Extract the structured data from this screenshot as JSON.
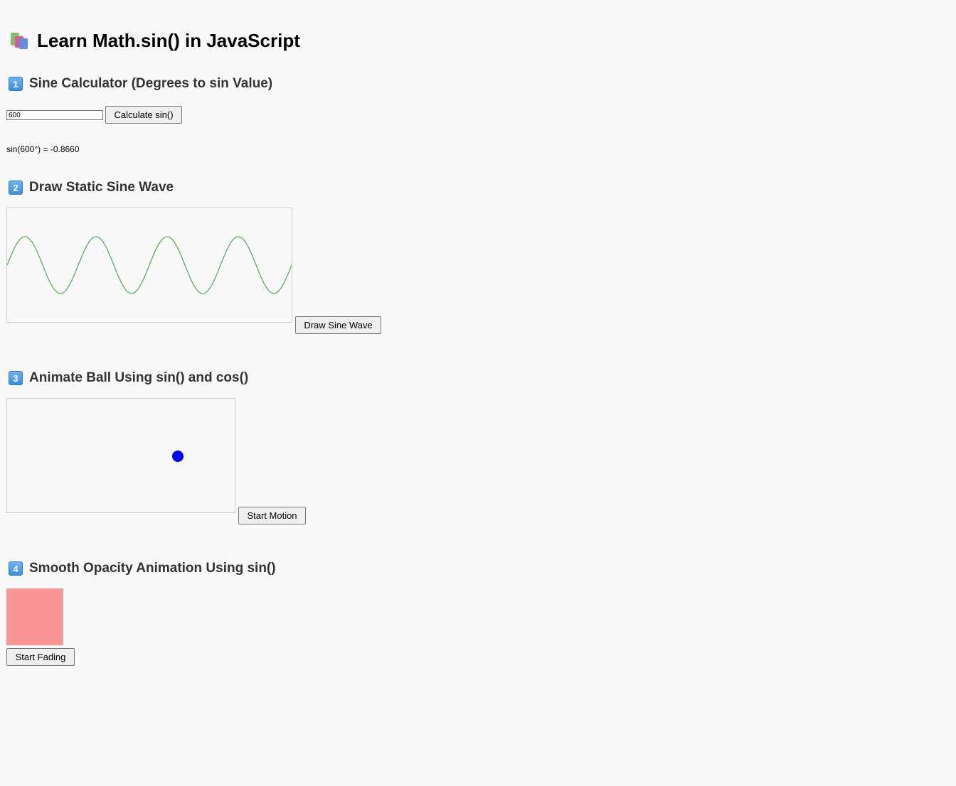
{
  "header": {
    "title": "Learn Math.sin() in JavaScript",
    "icon": "books-icon"
  },
  "sections": [
    {
      "number": "1",
      "title": "Sine Calculator (Degrees to sin Value)",
      "input_value": "600",
      "button_label": "Calculate sin()",
      "result": "sin(600°) = -0.8660"
    },
    {
      "number": "2",
      "title": "Draw Static Sine Wave",
      "button_label": "Draw Sine Wave",
      "wave_color": "#4caf50",
      "wave_cycles": 4
    },
    {
      "number": "3",
      "title": "Animate Ball Using sin() and cos()",
      "button_label": "Start Motion",
      "ball_color": "#0000ff"
    },
    {
      "number": "4",
      "title": "Smooth Opacity Animation Using sin()",
      "button_label": "Start Fading",
      "box_color": "#ff0000",
      "box_opacity": 0.4
    }
  ]
}
